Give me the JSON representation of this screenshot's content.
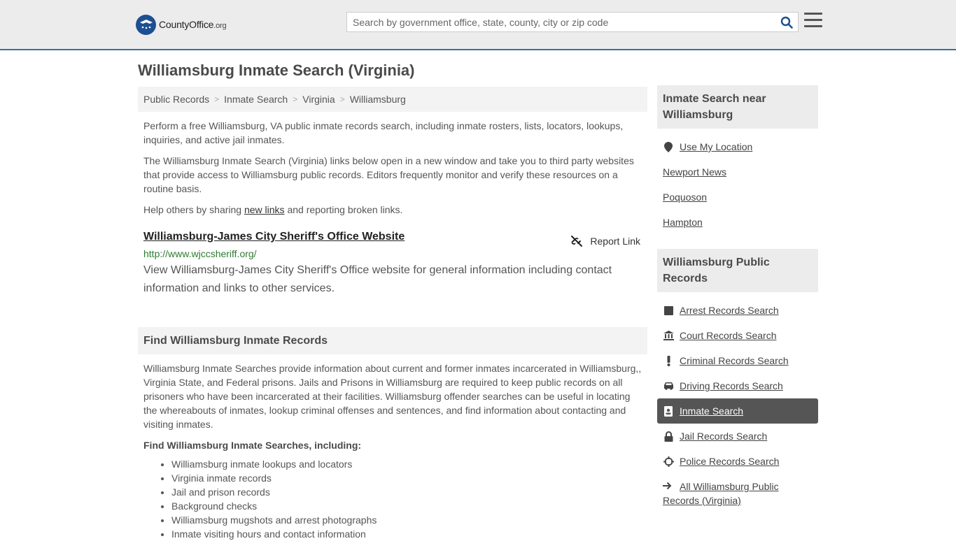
{
  "header": {
    "logo_text_main": "CountyOffice",
    "logo_text_org": ".org",
    "search_placeholder": "Search by government office, state, county, city or zip code"
  },
  "page_title": "Williamsburg Inmate Search (Virginia)",
  "breadcrumb": [
    "Public Records",
    "Inmate Search",
    "Virginia",
    "Williamsburg"
  ],
  "intro": {
    "p1": "Perform a free Williamsburg, VA public inmate records search, including inmate rosters, lists, locators, lookups, inquiries, and active jail inmates.",
    "p2": "The Williamsburg Inmate Search (Virginia) links below open in a new window and take you to third party websites that provide access to Williamsburg public records. Editors frequently monitor and verify these resources on a routine basis.",
    "p3_before": "Help others by sharing ",
    "p3_link": "new links",
    "p3_after": " and reporting broken links."
  },
  "link": {
    "title": "Williamsburg-James City Sheriff's Office Website",
    "url": "http://www.wjccsheriff.org/",
    "description": "View Williamsburg-James City Sheriff's Office website for general information including contact information and links to other services.",
    "report_label": "Report Link"
  },
  "find_section": {
    "heading": "Find Williamsburg Inmate Records",
    "paragraph": "Williamsburg Inmate Searches provide information about current and former inmates incarcerated in Williamsburg,, Virginia State, and Federal prisons. Jails and Prisons in Williamsburg are required to keep public records on all prisoners who have been incarcerated at their facilities. Williamsburg offender searches can be useful in locating the whereabouts of inmates, lookup criminal offenses and sentences, and find information about contacting and visiting inmates.",
    "subheading": "Find Williamsburg Inmate Searches, including:",
    "bullets": [
      "Williamsburg inmate lookups and locators",
      "Virginia inmate records",
      "Jail and prison records",
      "Background checks",
      "Williamsburg mugshots and arrest photographs",
      "Inmate visiting hours and contact information"
    ]
  },
  "sidebar": {
    "near_heading": "Inmate Search near Williamsburg",
    "near_items": [
      "Use My Location",
      "Newport News",
      "Poquoson",
      "Hampton"
    ],
    "records_heading": "Williamsburg Public Records",
    "records_items": [
      {
        "label": "Arrest Records Search",
        "icon": "square-icon"
      },
      {
        "label": "Court Records Search",
        "icon": "courthouse-icon"
      },
      {
        "label": "Criminal Records Search",
        "icon": "exclamation-icon"
      },
      {
        "label": "Driving Records Search",
        "icon": "car-icon"
      },
      {
        "label": "Inmate Search",
        "icon": "id-badge-icon"
      },
      {
        "label": "Jail Records Search",
        "icon": "lock-icon"
      },
      {
        "label": "Police Records Search",
        "icon": "crosshair-icon"
      }
    ],
    "all_link": "All Williamsburg Public Records (Virginia)"
  },
  "colors": {
    "accent_border": "#3a6ea5",
    "active_bg": "#555555",
    "url_green": "#2e7d32"
  }
}
